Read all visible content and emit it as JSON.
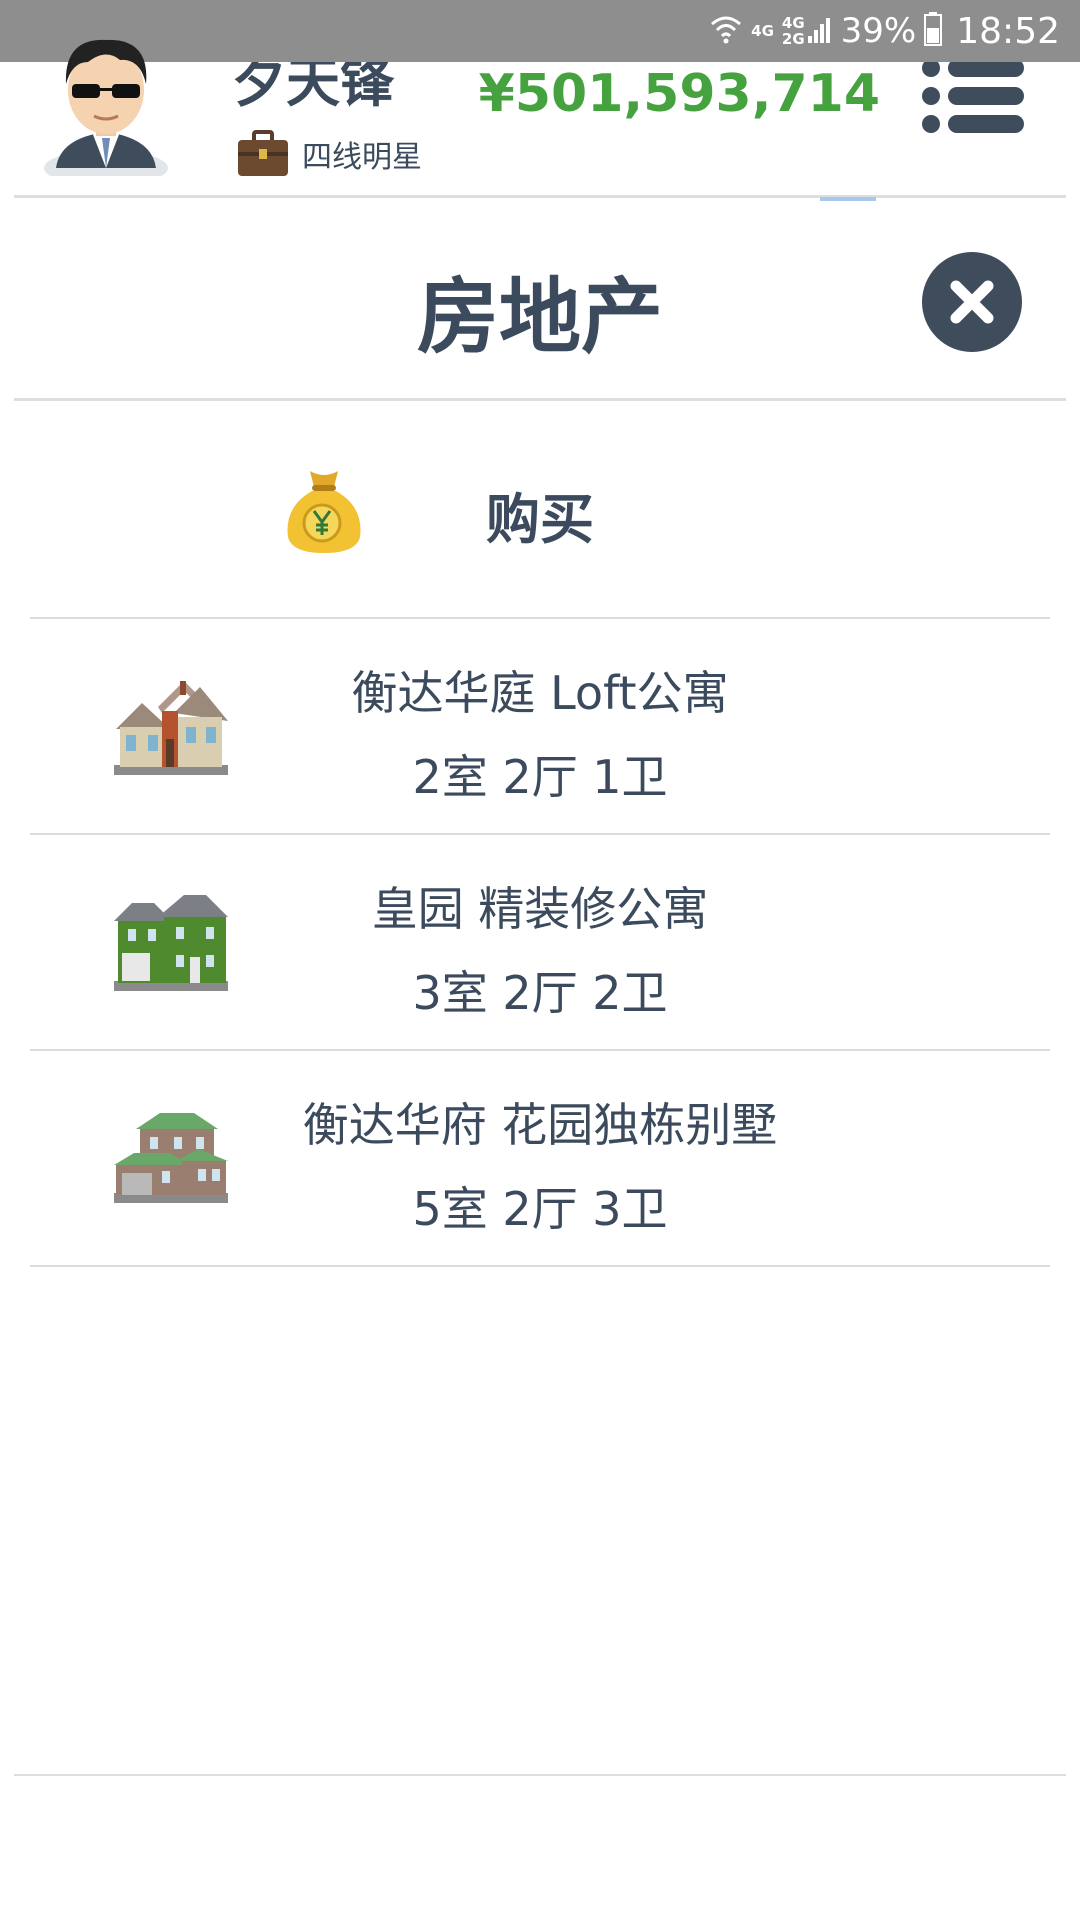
{
  "status_bar": {
    "network_top": "4G",
    "network_mid": "4G",
    "network_bottom": "2G",
    "battery_percent": "39%",
    "time": "18:52",
    "icons": [
      "wifi-icon",
      "signal-icon",
      "battery-icon"
    ]
  },
  "header": {
    "user_name": "夕天锋",
    "rank": "四线明星",
    "money": "¥501,593,714",
    "icons": [
      "avatar",
      "briefcase-icon",
      "menu-icon"
    ]
  },
  "page": {
    "title": "房地产",
    "close_icon": "close-icon"
  },
  "buy": {
    "label": "购买",
    "icon": "money-bag-icon"
  },
  "properties": [
    {
      "name": "衡达华庭 Loft公寓",
      "rooms": "2室 2厅 1卫",
      "icon": "house-icon"
    },
    {
      "name": "皇园 精装修公寓",
      "rooms": "3室 2厅 2卫",
      "icon": "green-house-icon"
    },
    {
      "name": "衡达华府 花园独栋别墅",
      "rooms": "5室 2厅 3卫",
      "icon": "villa-icon"
    }
  ],
  "colors": {
    "text": "#3b4a5c",
    "money": "#45a23f",
    "status_bar": "#8e8e8e",
    "divider": "#dadfe3"
  }
}
